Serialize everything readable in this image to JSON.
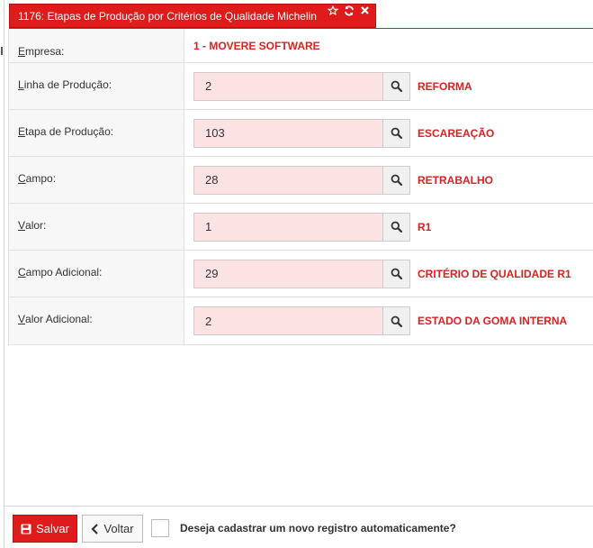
{
  "window": {
    "title": "1176: Etapas de Produção por Critérios de Qualidade Michelin",
    "accent_color": "#e01b1b",
    "tools": [
      "star-icon",
      "refresh-icon",
      "close-icon"
    ]
  },
  "form": {
    "empresa": {
      "label": "Empresa:",
      "value": "1 - MOVERE SOFTWARE"
    },
    "fields": [
      {
        "key": "linha",
        "label": "Linha de Produção:",
        "value": "2",
        "description": "REFORMA"
      },
      {
        "key": "etapa",
        "label": "Etapa de Produção:",
        "value": "103",
        "description": "ESCAREAÇÃO"
      },
      {
        "key": "campo",
        "label": "Campo:",
        "value": "28",
        "description": "RETRABALHO"
      },
      {
        "key": "valor",
        "label": "Valor:",
        "value": "1",
        "description": "R1"
      },
      {
        "key": "campo_adicional",
        "label": "Campo Adicional:",
        "value": "29",
        "description": "CRITÉRIO DE QUALIDADE R1"
      },
      {
        "key": "valor_adicional",
        "label": "Valor Adicional:",
        "value": "2",
        "description": "ESTADO DA GOMA INTERNA"
      }
    ]
  },
  "footer": {
    "save_label": "Salvar",
    "back_label": "Voltar",
    "auto_new_label": "Deseja cadastrar um novo registro automaticamente?",
    "auto_new_checked": false
  }
}
